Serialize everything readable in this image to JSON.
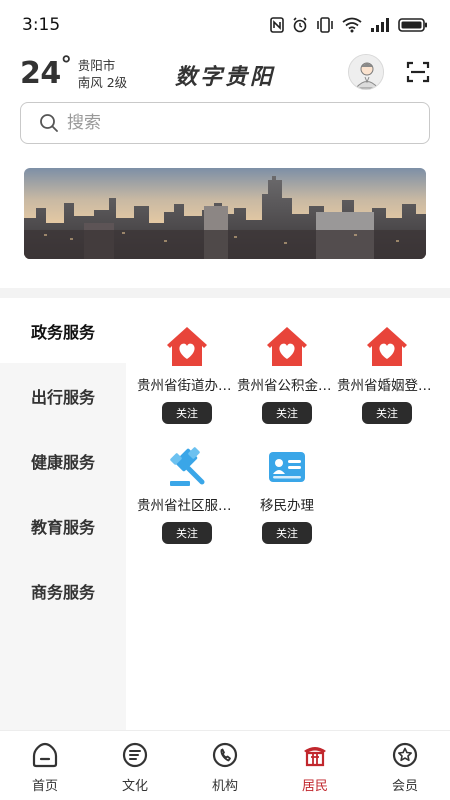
{
  "status_bar": {
    "time": "3:15"
  },
  "header": {
    "temperature": "24",
    "degree_symbol": "°",
    "city": "贵阳市",
    "wind": "南风  2级",
    "title": "数字贵阳"
  },
  "search": {
    "placeholder": "搜索"
  },
  "categories": [
    {
      "label": "政务服务",
      "active": true
    },
    {
      "label": "出行服务",
      "active": false
    },
    {
      "label": "健康服务",
      "active": false
    },
    {
      "label": "教育服务",
      "active": false
    },
    {
      "label": "商务服务",
      "active": false
    }
  ],
  "services": [
    {
      "label": "贵州省街道办事处",
      "icon": "heart-house-icon",
      "follow": "关注"
    },
    {
      "label": "贵州省公积金中心",
      "icon": "heart-house-icon",
      "follow": "关注"
    },
    {
      "label": "贵州省婚姻登记处",
      "icon": "heart-house-icon",
      "follow": "关注"
    },
    {
      "label": "贵州省社区服务中心",
      "icon": "gavel-icon",
      "follow": "关注"
    },
    {
      "label": "移民办理",
      "icon": "id-card-icon",
      "follow": "关注"
    }
  ],
  "bottom_nav": [
    {
      "label": "首页",
      "icon": "home-icon",
      "active": false
    },
    {
      "label": "文化",
      "icon": "culture-icon",
      "active": false
    },
    {
      "label": "机构",
      "icon": "organization-icon",
      "active": false
    },
    {
      "label": "居民",
      "icon": "resident-icon",
      "active": true
    },
    {
      "label": "会员",
      "icon": "member-icon",
      "active": false
    }
  ],
  "colors": {
    "accent": "#c1272d",
    "service_red": "#e8443a",
    "service_blue": "#3aa6e8",
    "follow_button": "#2c2c2c"
  }
}
